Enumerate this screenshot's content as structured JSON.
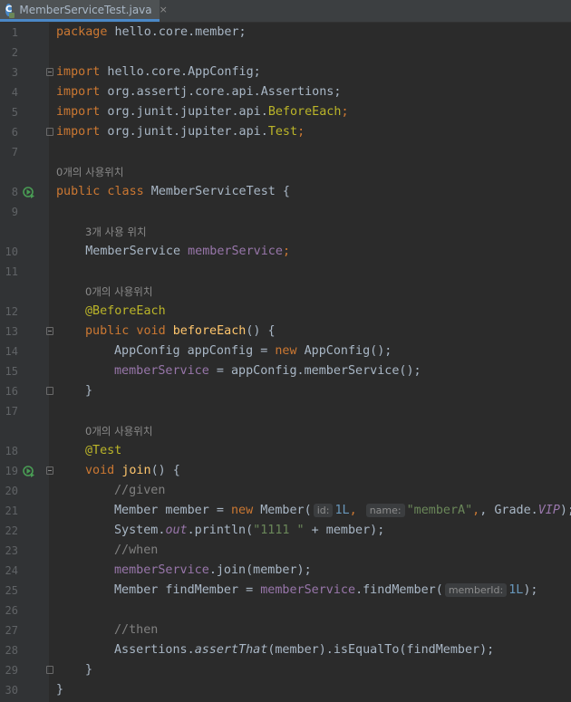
{
  "tab": {
    "label": "MemberServiceTest.java",
    "icon": "java-test-class-icon",
    "close": "×"
  },
  "hints": {
    "usage0": "0개의 사용위치",
    "usage3": "3개 사용 위치"
  },
  "code": {
    "l1_pkg": "package",
    "l1_rest": " hello.core.member;",
    "l3_kw": "import",
    "l3_rest": " hello.core.AppConfig;",
    "l4_kw": "import",
    "l4_rest": " org.assertj.core.api.Assertions;",
    "l5_kw": "import",
    "l5_rest": " org.junit.jupiter.api.",
    "l5_ann": "BeforeEach",
    "l5_semi": ";",
    "l6_kw": "import",
    "l6_rest": " org.junit.jupiter.api.",
    "l6_ann": "Test",
    "l6_semi": ";",
    "l8_kw": "public class",
    "l8_rest": " MemberServiceTest {",
    "l10_type": "    MemberService ",
    "l10_fld": "memberService",
    "l10_semi": ";",
    "l12_ann": "@BeforeEach",
    "l13_kw": "public void",
    "l13_fn": "beforeEach",
    "l13_rest": "() {",
    "l14_a": "AppConfig appConfig = ",
    "l14_new": "new",
    "l14_b": " AppConfig();",
    "l15_fld": "memberService",
    "l15_rest": " = appConfig.memberService();",
    "l16": "}",
    "l18_ann": "@Test",
    "l19_kw": "void",
    "l19_fn": "join",
    "l19_rest": "() {",
    "l20_cmt": "//given",
    "l21_a": "Member member = ",
    "l21_new": "new",
    "l21_b": " Member(",
    "l21_ph1": "id:",
    "l21_n1": "1L",
    "l21_c": ", ",
    "l21_ph2": "name:",
    "l21_str": "\"memberA\"",
    "l21_d": ", Grade.",
    "l21_vip": "VIP",
    "l21_e": ");",
    "l22_a": "System.",
    "l22_out": "out",
    "l22_b": ".println(",
    "l22_str": "\"1111 \"",
    "l22_c": " + member);",
    "l23_cmt": "//when",
    "l24_fld": "memberService",
    "l24_rest": ".join(member);",
    "l25_a": "Member findMember = ",
    "l25_fld": "memberService",
    "l25_b": ".findMember(",
    "l25_ph": "memberId:",
    "l25_n": "1L",
    "l25_c": ");",
    "l27_cmt": "//then",
    "l28_a": "Assertions.",
    "l28_fn": "assertThat",
    "l28_b": "(member).isEqualTo(findMember);",
    "l29": "}",
    "l30": "}"
  },
  "line_numbers": [
    "1",
    "2",
    "3",
    "4",
    "5",
    "6",
    "7",
    "8",
    "9",
    "10",
    "11",
    "12",
    "13",
    "14",
    "15",
    "16",
    "17",
    "18",
    "19",
    "20",
    "21",
    "22",
    "23",
    "24",
    "25",
    "26",
    "27",
    "28",
    "29",
    "30"
  ],
  "colors": {
    "background": "#2b2b2b",
    "keyword": "#cc7832",
    "field": "#9876aa",
    "function": "#ffc66d",
    "annotation": "#bbb529",
    "string": "#6a8759",
    "number": "#6897bb",
    "comment": "#808080",
    "text": "#a9b7c6"
  }
}
